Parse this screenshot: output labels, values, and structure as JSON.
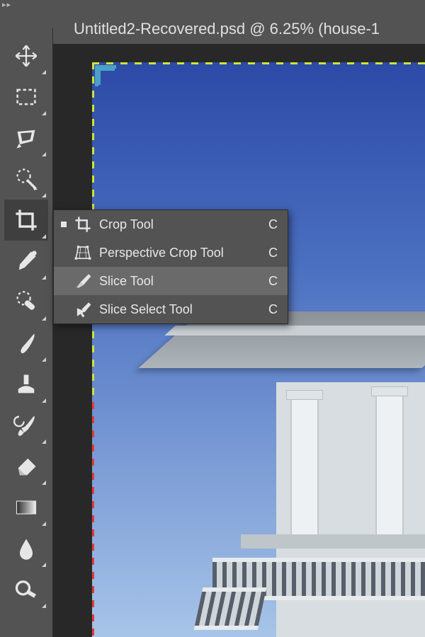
{
  "header": {
    "document_tab": "Untitled2-Recovered.psd @ 6.25% (house-1"
  },
  "toolbar": {
    "tools": [
      {
        "name": "move-tool"
      },
      {
        "name": "rectangular-marquee-tool"
      },
      {
        "name": "lasso-tool"
      },
      {
        "name": "quick-selection-tool"
      },
      {
        "name": "crop-tool",
        "active": true
      },
      {
        "name": "eyedropper-tool"
      },
      {
        "name": "spot-healing-brush-tool"
      },
      {
        "name": "brush-tool"
      },
      {
        "name": "clone-stamp-tool"
      },
      {
        "name": "history-brush-tool"
      },
      {
        "name": "eraser-tool"
      },
      {
        "name": "gradient-tool"
      },
      {
        "name": "blur-tool"
      },
      {
        "name": "dodge-tool"
      }
    ]
  },
  "flyout": {
    "items": [
      {
        "label": "Crop Tool",
        "shortcut": "C",
        "selected": true,
        "icon": "crop-icon"
      },
      {
        "label": "Perspective Crop Tool",
        "shortcut": "C",
        "selected": false,
        "icon": "perspective-crop-icon"
      },
      {
        "label": "Slice Tool",
        "shortcut": "C",
        "selected": false,
        "icon": "slice-icon",
        "hovered": true
      },
      {
        "label": "Slice Select Tool",
        "shortcut": "C",
        "selected": false,
        "icon": "slice-select-icon"
      }
    ]
  },
  "document": {
    "zoom_percent": 6.25
  },
  "colors": {
    "panel_bg": "#535353",
    "canvas_bg": "#282828",
    "crop_marquee": "#cde438",
    "slice_marker": "#4aa0c7"
  }
}
